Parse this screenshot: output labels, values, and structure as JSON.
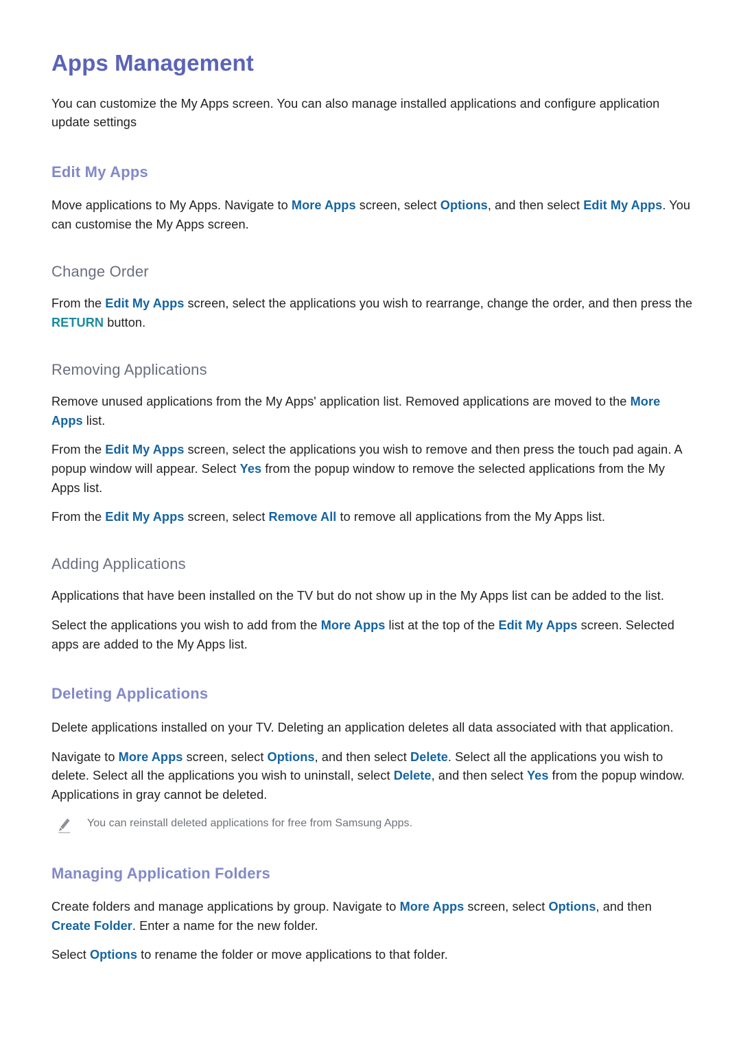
{
  "page": {
    "title": "Apps Management",
    "intro": "You can customize the My Apps screen. You can also manage installed applications and configure application update settings"
  },
  "colors": {
    "title": "#5a63b8",
    "section_heading": "#8289c8",
    "sub_heading": "#6b6e80",
    "keyword_blue": "#1464a0",
    "keyword_teal": "#1b8b9e",
    "body_text": "#231f20",
    "note_text": "#6e7278",
    "background": "#ffffff"
  },
  "sections": [
    {
      "id": "edit-my-apps",
      "heading": "Edit My Apps",
      "level": "h2",
      "paragraphs": [
        {
          "id": "edit-my-apps-p1",
          "parts": [
            {
              "t": "Move applications to My Apps. Navigate to ",
              "s": "plain"
            },
            {
              "t": "More Apps",
              "s": "kw"
            },
            {
              "t": " screen, select ",
              "s": "plain"
            },
            {
              "t": "Options",
              "s": "kw"
            },
            {
              "t": ", and then select ",
              "s": "plain"
            },
            {
              "t": "Edit My Apps",
              "s": "kw"
            },
            {
              "t": ". You can customise the My Apps screen.",
              "s": "plain"
            }
          ]
        }
      ],
      "subsections": [
        {
          "id": "change-order",
          "heading": "Change Order",
          "level": "h3",
          "paragraphs": [
            {
              "id": "change-order-p1",
              "parts": [
                {
                  "t": "From the ",
                  "s": "plain"
                },
                {
                  "t": "Edit My Apps",
                  "s": "kw"
                },
                {
                  "t": " screen, select the applications you wish to rearrange, change the order, and then press the ",
                  "s": "plain"
                },
                {
                  "t": "RETURN",
                  "s": "kw-teal"
                },
                {
                  "t": " button.",
                  "s": "plain"
                }
              ]
            }
          ]
        },
        {
          "id": "removing-applications",
          "heading": "Removing Applications",
          "level": "h3",
          "paragraphs": [
            {
              "id": "removing-applications-p1",
              "parts": [
                {
                  "t": "Remove unused applications from the My Apps' application list. Removed applications are moved to the ",
                  "s": "plain"
                },
                {
                  "t": "More Apps",
                  "s": "kw"
                },
                {
                  "t": " list.",
                  "s": "plain"
                }
              ]
            },
            {
              "id": "removing-applications-p2",
              "parts": [
                {
                  "t": "From the ",
                  "s": "plain"
                },
                {
                  "t": "Edit My Apps",
                  "s": "kw"
                },
                {
                  "t": " screen, select the applications you wish to remove and then press the touch pad again. A popup window will appear. Select ",
                  "s": "plain"
                },
                {
                  "t": "Yes",
                  "s": "kw"
                },
                {
                  "t": " from the popup window to remove the selected applications from the My Apps list.",
                  "s": "plain"
                }
              ]
            },
            {
              "id": "removing-applications-p3",
              "parts": [
                {
                  "t": "From the ",
                  "s": "plain"
                },
                {
                  "t": "Edit My Apps",
                  "s": "kw"
                },
                {
                  "t": " screen, select ",
                  "s": "plain"
                },
                {
                  "t": "Remove All",
                  "s": "kw"
                },
                {
                  "t": " to remove all applications from the My Apps list.",
                  "s": "plain"
                }
              ]
            }
          ]
        },
        {
          "id": "adding-applications",
          "heading": "Adding Applications",
          "level": "h3",
          "paragraphs": [
            {
              "id": "adding-applications-p1",
              "parts": [
                {
                  "t": "Applications that have been installed on the TV but do not show up in the My Apps list can be added to the list.",
                  "s": "plain"
                }
              ]
            },
            {
              "id": "adding-applications-p2",
              "parts": [
                {
                  "t": "Select the applications you wish to add from the ",
                  "s": "plain"
                },
                {
                  "t": "More Apps",
                  "s": "kw"
                },
                {
                  "t": " list at the top of the ",
                  "s": "plain"
                },
                {
                  "t": "Edit My Apps",
                  "s": "kw"
                },
                {
                  "t": " screen. Selected apps are added to the My Apps list.",
                  "s": "plain"
                }
              ]
            }
          ]
        }
      ]
    },
    {
      "id": "deleting-applications",
      "heading": "Deleting Applications",
      "level": "h2",
      "paragraphs": [
        {
          "id": "deleting-applications-p1",
          "parts": [
            {
              "t": "Delete applications installed on your TV. Deleting an application deletes all data associated with that application.",
              "s": "plain"
            }
          ]
        },
        {
          "id": "deleting-applications-p2",
          "parts": [
            {
              "t": "Navigate to ",
              "s": "plain"
            },
            {
              "t": "More Apps",
              "s": "kw"
            },
            {
              "t": " screen, select ",
              "s": "plain"
            },
            {
              "t": "Options",
              "s": "kw"
            },
            {
              "t": ", and then select ",
              "s": "plain"
            },
            {
              "t": "Delete",
              "s": "kw"
            },
            {
              "t": ". Select all the applications you wish to delete. Select all the applications you wish to uninstall, select ",
              "s": "plain"
            },
            {
              "t": "Delete",
              "s": "kw"
            },
            {
              "t": ", and then select ",
              "s": "plain"
            },
            {
              "t": "Yes",
              "s": "kw"
            },
            {
              "t": " from the popup window. Applications in gray cannot be deleted.",
              "s": "plain"
            }
          ]
        }
      ],
      "note": {
        "icon": "pencil-icon",
        "text": "You can reinstall deleted applications for free from Samsung Apps."
      },
      "subsections": []
    },
    {
      "id": "managing-application-folders",
      "heading": "Managing Application Folders",
      "level": "h2",
      "paragraphs": [
        {
          "id": "managing-application-folders-p1",
          "parts": [
            {
              "t": "Create folders and manage applications by group. Navigate to ",
              "s": "plain"
            },
            {
              "t": "More Apps",
              "s": "kw"
            },
            {
              "t": " screen, select ",
              "s": "plain"
            },
            {
              "t": "Options",
              "s": "kw"
            },
            {
              "t": ", and then ",
              "s": "plain"
            },
            {
              "t": "Create Folder",
              "s": "kw"
            },
            {
              "t": ". Enter a name for the new folder.",
              "s": "plain"
            }
          ]
        },
        {
          "id": "managing-application-folders-p2",
          "parts": [
            {
              "t": "Select ",
              "s": "plain"
            },
            {
              "t": "Options",
              "s": "kw"
            },
            {
              "t": " to rename the folder or move applications to that folder.",
              "s": "plain"
            }
          ]
        }
      ],
      "subsections": []
    }
  ]
}
